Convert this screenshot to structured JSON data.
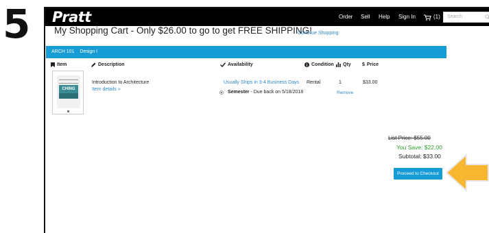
{
  "step": "5",
  "nav": {
    "logo": "Pratt",
    "order": "Order",
    "sell": "Sell",
    "help": "Help",
    "sign_in": "Sign In",
    "cart": "(1)",
    "search_placeholder": "Search"
  },
  "cart": {
    "heading": "My Shopping Cart - Only $26.00 to go to get FREE SHIPPING!",
    "continue_shopping": "Continue Shopping",
    "course_code": "ARCH  101",
    "course_name": "Design I"
  },
  "table_headers": {
    "item": "Item",
    "description": "Description",
    "availability": "Availability",
    "condition": "Condition",
    "qty": "Qty",
    "price": "Price"
  },
  "line_item": {
    "cover_text": "CHING",
    "title": "Introduction to Architecture",
    "details_link": "Item details »",
    "availability": "Usually Ships in 3-4 Business Days",
    "term_label": "Semester",
    "term_due": " - Due back on 5/18/2018",
    "condition": "Rental",
    "qty": "1",
    "remove": "Remove",
    "price": "$33.00"
  },
  "summary": {
    "list_price": "List Price: $55.00",
    "you_save": "You Save: $22.00",
    "subtotal": "Subtotal: $33.00",
    "checkout_button": "Proceed to Checkout"
  },
  "colors": {
    "accent": "#169bd5",
    "link": "#2e8ac7",
    "save_green": "#2a9d2a",
    "arrow": "#f7b731"
  }
}
